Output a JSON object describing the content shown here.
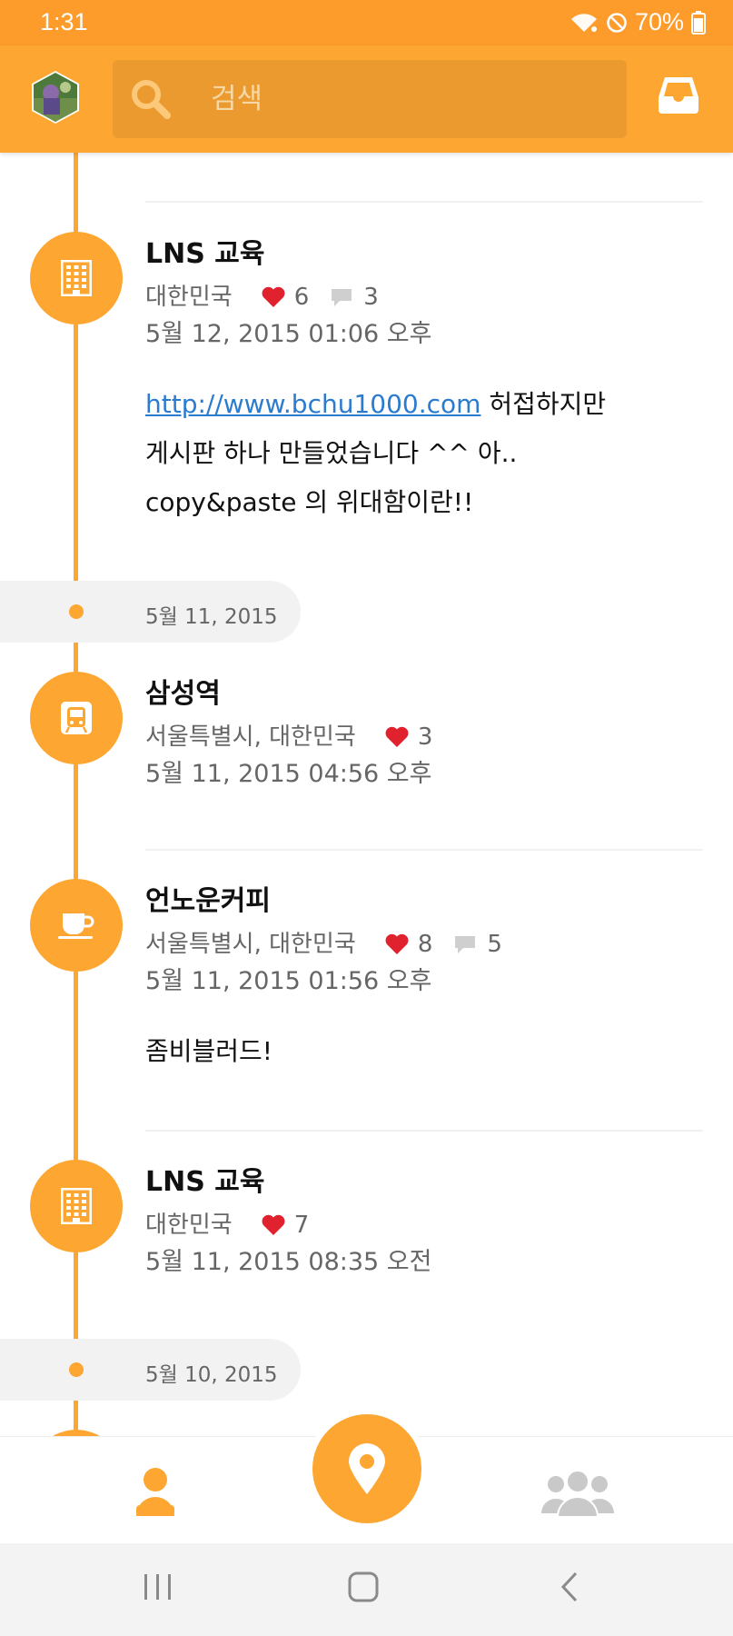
{
  "status_bar": {
    "time": "1:31",
    "battery": "70%"
  },
  "header": {
    "search_placeholder": "검색"
  },
  "colors": {
    "accent": "#fda732",
    "status_bar": "#fd9b2b",
    "heart": "#e0212e",
    "link": "#2b7bd0"
  },
  "feed": {
    "entries": [
      {
        "title": "LNS 교육",
        "location": "대한민국",
        "likes": "6",
        "comments": "3",
        "time": "5월 12, 2015 01:06 오후",
        "icon": "building-icon",
        "body_link": "http://www.bchu1000.com",
        "body_line1": " 허접하지만",
        "body_line2": "게시판 하나 만들었습니다 ^^ 아..",
        "body_line3": "copy&paste 의 위대함이란!!"
      },
      {
        "title": "삼성역",
        "location": "서울특별시, 대한민국",
        "likes": "3",
        "time": "5월 11, 2015 04:56 오후",
        "icon": "subway-icon"
      },
      {
        "title": "언노운커피",
        "location": "서울특별시, 대한민국",
        "likes": "8",
        "comments": "5",
        "time": "5월 11, 2015 01:56 오후",
        "icon": "coffee-cup-icon",
        "body": "좀비블러드!"
      },
      {
        "title": "LNS 교육",
        "location": "대한민국",
        "likes": "7",
        "time": "5월 11, 2015 08:35 오전",
        "icon": "building-icon"
      }
    ],
    "date_headers": [
      "5월 11, 2015",
      "5월 10, 2015"
    ]
  },
  "bottom_nav": {
    "items": [
      {
        "icon": "person-icon"
      },
      {
        "icon": "location-pin-icon"
      },
      {
        "icon": "people-icon"
      }
    ]
  }
}
